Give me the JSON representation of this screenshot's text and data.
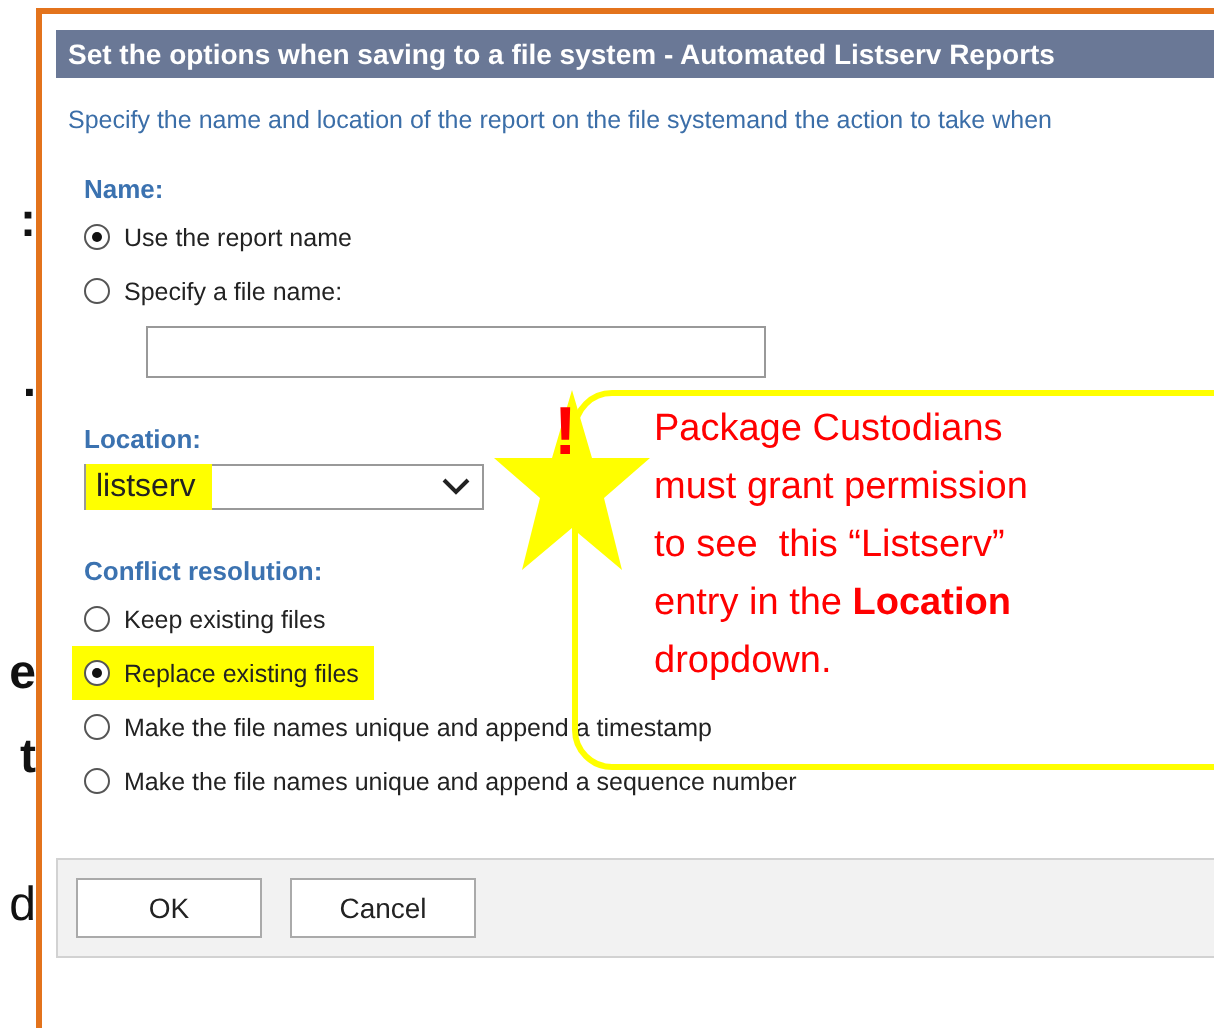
{
  "side_text": [
    ":",
    ".",
    "e",
    "t",
    "d"
  ],
  "dialog": {
    "title": "Set the options when saving to a file system - Automated Listserv Reports",
    "description": "Specify the name and location of the report on the file systemand the action to take when",
    "name_section": {
      "label": "Name:",
      "options": [
        {
          "label": "Use the report name",
          "selected": true
        },
        {
          "label": "Specify a file name:",
          "selected": false
        }
      ]
    },
    "location": {
      "label": "Location:",
      "value": "listserv",
      "highlighted": true
    },
    "conflict_resolution": {
      "label": "Conflict resolution:",
      "options": [
        {
          "label": "Keep existing files",
          "selected": false,
          "highlighted": false
        },
        {
          "label": "Replace existing files",
          "selected": true,
          "highlighted": true
        },
        {
          "label": "Make the file names unique and append a timestamp",
          "selected": false,
          "highlighted": false
        },
        {
          "label": "Make the file names unique and append a sequence number",
          "selected": false,
          "highlighted": false
        }
      ]
    },
    "buttons": [
      "OK",
      "Cancel"
    ]
  },
  "callout": {
    "mark": "!",
    "text": "Package Custodians\nmust grant permission\nto see  this “Listserv”\nentry in the **Location**\ndropdown."
  }
}
